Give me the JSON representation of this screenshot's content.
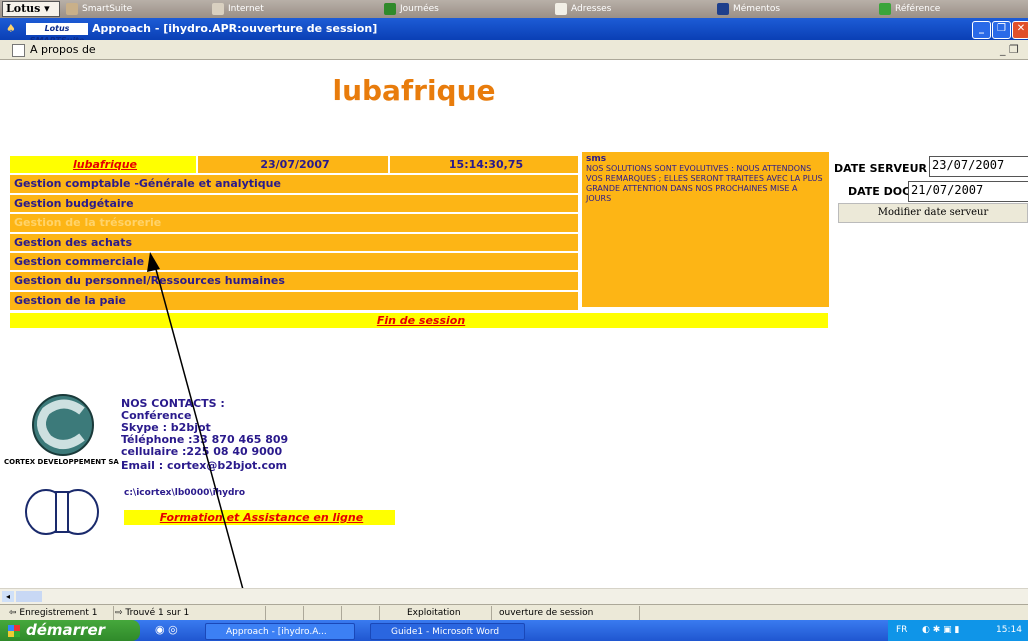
{
  "suitebar": {
    "lotus": "Lotus",
    "items": [
      "SmartSuite",
      "Internet",
      "Journées",
      "Adresses",
      "Mémentos",
      "Référence"
    ]
  },
  "titlebar": {
    "logo": "Lotus SMARTSuite",
    "title": "Approach - [ihydro.APR:ouverture de session]"
  },
  "menubar": {
    "about": "A propos de"
  },
  "app": {
    "title": "lubafrique",
    "header": {
      "company": "lubafrique",
      "date": "23/07/2007",
      "time": "15:14:30,75"
    },
    "menu": [
      "Gestion comptable -Générale et analytique",
      "Gestion budgétaire",
      "Gestion de la trésorerie",
      "Gestion des achats",
      "Gestion commerciale",
      "Gestion du personnel/Ressources humaines",
      "Gestion de la paie"
    ],
    "end_session": "Fin de session",
    "sms": {
      "title": "sms",
      "text": "NOS SOLUTIONS SONT EVOLUTIVES : NOUS ATTENDONS VOS REMARQUES ; ELLES SERONT TRAITEES AVEC LA PLUS GRANDE ATTENTION DANS NOS PROCHAINES MISE A JOURS"
    },
    "server_date": {
      "label": "DATE SERVEUR",
      "value": "23/07/2007"
    },
    "doc_date": {
      "label": "DATE DOC",
      "value": "21/07/2007"
    },
    "modify_button": "Modifier date serveur",
    "contacts": {
      "heading": "NOS CONTACTS :",
      "lines": [
        "Conférence",
        "Skype : b2bjot",
        "Téléphone :33 870 465 809",
        "cellulaire :225 08 40 9000",
        "Email : cortex@b2bjot.com"
      ]
    },
    "company_logo_caption": "CORTEX DEVELOPPEMENT SA",
    "path": "c:\\icortex\\lb0000\\ihydro",
    "training": "Formation et  Assistance en ligne"
  },
  "statusbar": {
    "record": "Enregistrement 1",
    "found": "Trouvé 1 sur 1",
    "mode": "Exploitation",
    "view": "ouverture de session"
  },
  "taskbar": {
    "start": "démarrer",
    "items": [
      "Approach - [ihydro.A...",
      "Guide1 - Microsoft Word"
    ],
    "lang": "FR",
    "clock": "15:14"
  }
}
